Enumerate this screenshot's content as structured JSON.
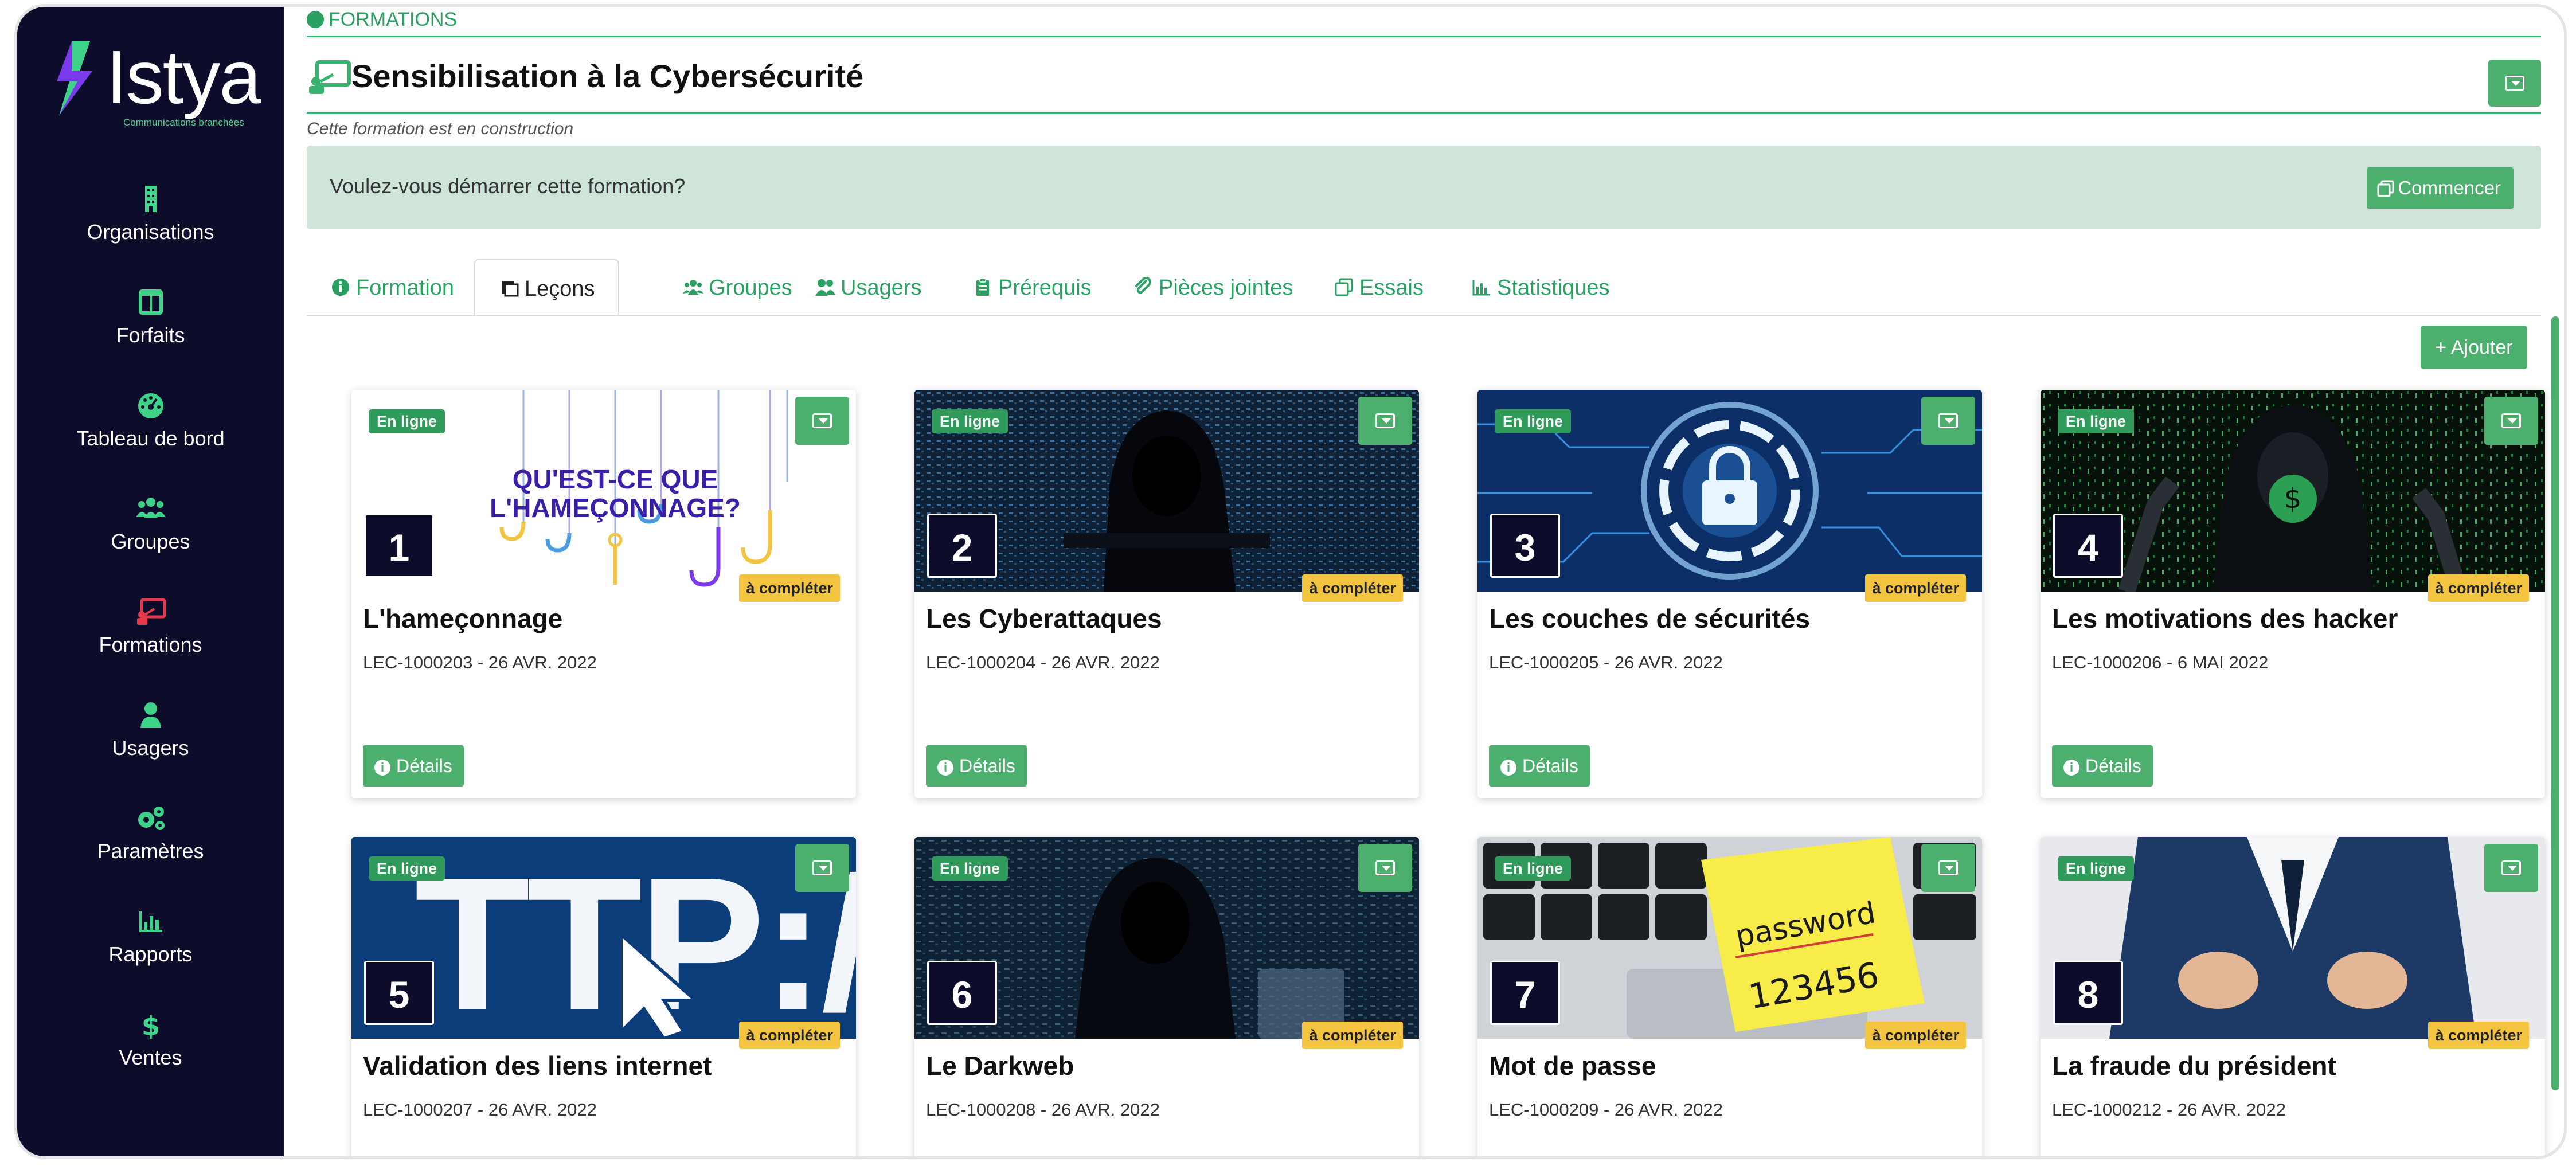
{
  "brand": {
    "name": "Istya",
    "tagline": "Communications branchées",
    "colors": {
      "sidebar": "#0d0d2b",
      "accent": "#4caf6e",
      "link": "#2aa163",
      "warning": "#f3c440",
      "banner": "#cfe5d9"
    }
  },
  "sidebar": {
    "items": [
      {
        "label": "Organisations",
        "icon": "building-icon"
      },
      {
        "label": "Forfaits",
        "icon": "columns-icon"
      },
      {
        "label": "Tableau de bord",
        "icon": "gauge-icon"
      },
      {
        "label": "Groupes",
        "icon": "users-group-icon"
      },
      {
        "label": "Formations",
        "icon": "presentation-icon",
        "active": true
      },
      {
        "label": "Usagers",
        "icon": "user-icon"
      },
      {
        "label": "Paramètres",
        "icon": "cogs-icon"
      },
      {
        "label": "Rapports",
        "icon": "bar-chart-icon"
      },
      {
        "label": "Ventes",
        "icon": "dollar-icon"
      }
    ]
  },
  "header": {
    "breadcrumb": "FORMATIONS",
    "title": "Sensibilisation à la Cybersécurité",
    "subtitle": "Cette formation est en construction"
  },
  "banner": {
    "question": "Voulez-vous démarrer cette formation?",
    "start_label": "Commencer"
  },
  "tabs": [
    {
      "label": "Formation",
      "icon": "info-icon"
    },
    {
      "label": "Leçons",
      "icon": "scroll-icon",
      "active": true
    },
    {
      "label": "Groupes",
      "icon": "users-group-icon"
    },
    {
      "label": "Usagers",
      "icon": "users-icon"
    },
    {
      "label": "Prérequis",
      "icon": "clipboard-icon"
    },
    {
      "label": "Pièces jointes",
      "icon": "paperclip-icon"
    },
    {
      "label": "Essais",
      "icon": "copy-icon"
    },
    {
      "label": "Statistiques",
      "icon": "area-chart-icon"
    }
  ],
  "add_label": "+ Ajouter",
  "lesson_card": {
    "online_label": "En ligne",
    "todo_label": "à compléter",
    "details_label": "Détails"
  },
  "lessons": [
    {
      "number": "1",
      "title": "L'hameçonnage",
      "meta": "LEC-1000203 - 26 AVR. 2022",
      "image_text": [
        "QU'EST-CE QUE",
        "L'HAMEÇONNAGE?"
      ]
    },
    {
      "number": "2",
      "title": "Les Cyberattaques",
      "meta": "LEC-1000204 - 26 AVR. 2022"
    },
    {
      "number": "3",
      "title": "Les couches de sécurités",
      "meta": "LEC-1000205 - 26 AVR. 2022"
    },
    {
      "number": "4",
      "title": "Les motivations des hacker",
      "meta": "LEC-1000206 - 6 MAI 2022"
    },
    {
      "number": "5",
      "title": "Validation des liens internet",
      "meta": "LEC-1000207 - 26 AVR. 2022",
      "image_text": [
        "TTP://WW"
      ]
    },
    {
      "number": "6",
      "title": "Le Darkweb",
      "meta": "LEC-1000208 - 26 AVR. 2022"
    },
    {
      "number": "7",
      "title": "Mot de passe",
      "meta": "LEC-1000209 - 26 AVR. 2022",
      "image_text": [
        "password",
        "123456"
      ]
    },
    {
      "number": "8",
      "title": "La fraude du président",
      "meta": "LEC-1000212 - 26 AVR. 2022"
    }
  ]
}
